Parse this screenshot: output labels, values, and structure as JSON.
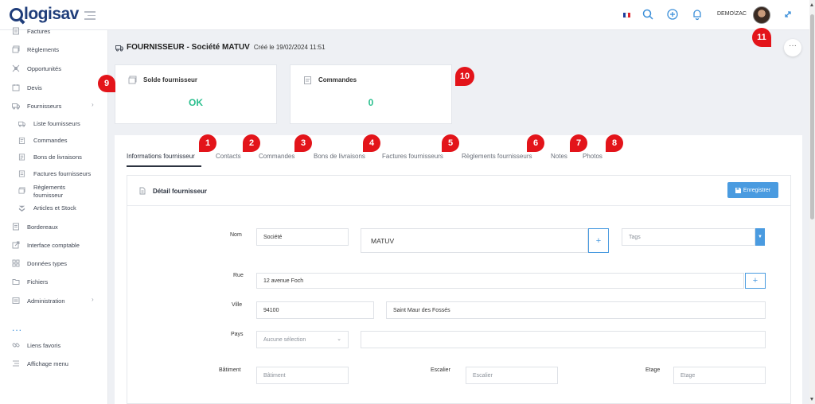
{
  "app": {
    "logo": "logisav"
  },
  "topbar": {
    "user_label": "DEMO\\ZAC",
    "flag_colors": [
      "#1d3d9c",
      "#ffffff",
      "#e0242b"
    ]
  },
  "sidebar": {
    "items": [
      {
        "label": "Factures",
        "icon": "file-icon"
      },
      {
        "label": "Règlements",
        "icon": "banknote-icon"
      },
      {
        "label": "Opportunités",
        "icon": "target-icon"
      },
      {
        "label": "Devis",
        "icon": "document-icon"
      },
      {
        "label": "Fournisseurs",
        "icon": "truck-icon"
      }
    ],
    "sub_items": [
      {
        "label": "Liste fournisseurs"
      },
      {
        "label": "Commandes"
      },
      {
        "label": "Bons de livraisons"
      },
      {
        "label": "Factures fournisseurs"
      },
      {
        "label": "Règlements fournisseur"
      },
      {
        "label": "Articles et Stock"
      }
    ],
    "items2": [
      {
        "label": "Bordereaux"
      },
      {
        "label": "Interface comptable"
      },
      {
        "label": "Données types"
      },
      {
        "label": "Fichiers"
      },
      {
        "label": "Administration"
      }
    ],
    "more_dots": "...",
    "bottom": [
      {
        "label": "Liens favoris"
      },
      {
        "label": "Affichage menu"
      }
    ]
  },
  "header": {
    "title": "FOURNISSEUR - Société MATUV",
    "created": "Créé le 19/02/2024 11:51"
  },
  "cards": [
    {
      "title": "Solde fournisseur",
      "value": "OK"
    },
    {
      "title": "Commandes",
      "value": "0"
    }
  ],
  "tabs": [
    "Informations fournisseur",
    "Contacts",
    "Commandes",
    "Bons de livraisons",
    "Factures fournisseurs",
    "Règlements fournisseurs",
    "Notes",
    "Photos"
  ],
  "detail": {
    "title": "Détail fournisseur",
    "save_label": "Enregistrer",
    "labels": {
      "nom": "Nom",
      "rue": "Rue",
      "ville": "Ville",
      "pays": "Pays",
      "batiment": "Bâtiment",
      "escalier": "Escalier",
      "etage": "Etage"
    },
    "fields": {
      "forme": "Société",
      "nom": "MATUV",
      "tags_placeholder": "Tags",
      "rue": "12 avenue Foch",
      "code_postal": "94100",
      "ville": "Saint Maur des Fossés",
      "pays": "Aucune sélection",
      "batiment_placeholder": "Bâtiment",
      "escalier_placeholder": "Escalier",
      "etage_placeholder": "Etage"
    }
  },
  "badges": [
    "1",
    "2",
    "3",
    "4",
    "5",
    "6",
    "7",
    "8",
    "9",
    "10",
    "11"
  ],
  "colors": {
    "accent": "#4a9be0",
    "success": "#2bbf8e",
    "badge": "#e3141a",
    "brand": "#1f3d7a"
  }
}
